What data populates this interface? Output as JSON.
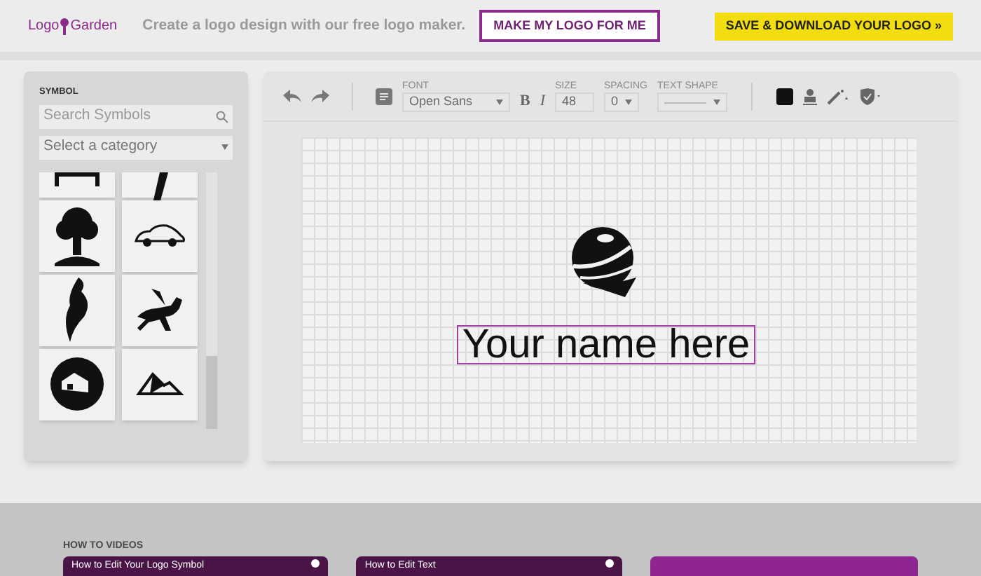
{
  "header": {
    "logo": [
      "Logo",
      "Garden"
    ],
    "tagline": "Create a logo design with our free logo maker.",
    "buttons": [
      {
        "label": "MAKE MY LOGO FOR ME",
        "kind": "outline"
      },
      {
        "label": "SAVE & DOWNLOAD YOUR LOGO »",
        "kind": "primary"
      }
    ]
  },
  "symbol_panel": {
    "title": "SYMBOL",
    "search": {
      "placeholder": "Search Symbols"
    },
    "category": {
      "value": "Select a category"
    }
  },
  "toolbar": {
    "font": {
      "label": "FONT",
      "value": "Open Sans"
    },
    "bold": "B",
    "italic": "I",
    "size": {
      "label": "SIZE",
      "value": "48"
    },
    "spacing": {
      "label": "SPACING",
      "value": "0"
    },
    "text_shape": {
      "label": "TEXT SHAPE"
    }
  },
  "canvas": {
    "text": "Your name here"
  },
  "videos": {
    "title": "HOW TO VIDEOS",
    "items": [
      {
        "title": "How to Edit Your Logo Symbol",
        "kind": "video"
      },
      {
        "title": "How to Edit Text",
        "kind": "video"
      },
      {
        "kind": "promo"
      }
    ]
  }
}
